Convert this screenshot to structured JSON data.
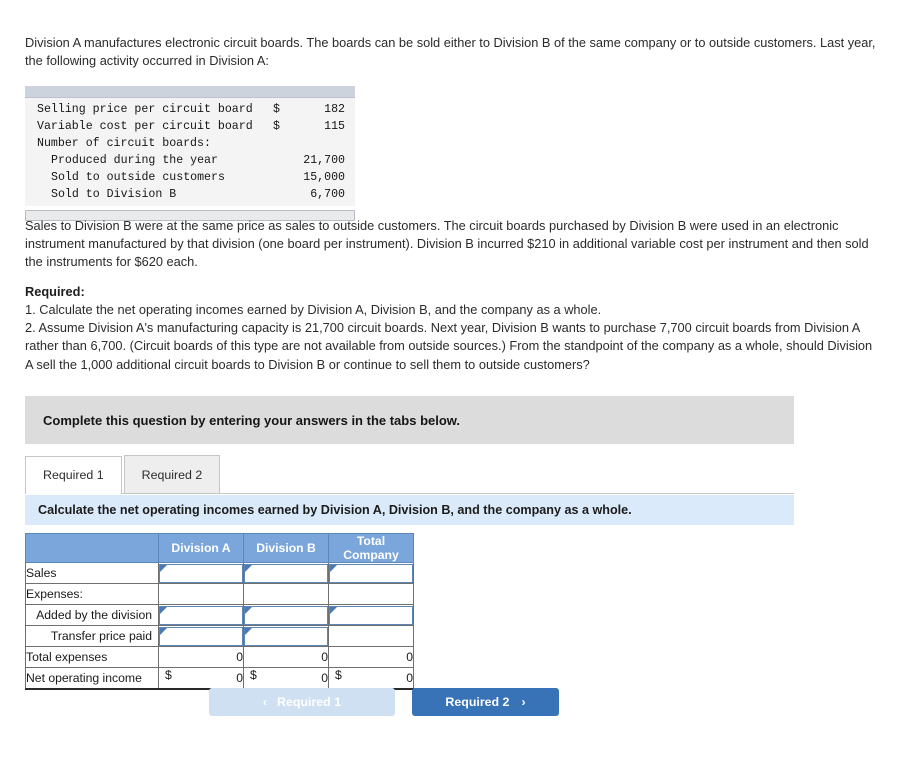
{
  "intro": {
    "paragraph": "Division A manufactures electronic circuit boards. The boards can be sold either to Division B of the same company or to outside customers. Last year, the following activity occurred in Division A:"
  },
  "exhibit": {
    "rows": [
      {
        "label": "Selling price per circuit board",
        "currency": "$",
        "value": "182",
        "indent": false
      },
      {
        "label": "Variable cost per circuit board",
        "currency": "$",
        "value": "115",
        "indent": false
      },
      {
        "label": "Number of circuit boards:",
        "currency": "",
        "value": "",
        "indent": false
      },
      {
        "label": "Produced during the year",
        "currency": "",
        "value": "21,700",
        "indent": true
      },
      {
        "label": "Sold to outside customers",
        "currency": "",
        "value": "15,000",
        "indent": true
      },
      {
        "label": "Sold to Division B",
        "currency": "",
        "value": "6,700",
        "indent": true
      }
    ]
  },
  "para_two": {
    "text": "Sales to Division B were at the same price as sales to outside customers. The circuit boards purchased by Division B were used in an electronic instrument manufactured by that division (one board per instrument). Division B incurred $210 in additional variable cost per instrument and then sold the instruments for $620 each."
  },
  "required": {
    "heading": "Required:",
    "items": [
      "1. Calculate the net operating incomes earned by Division A, Division B, and the company as a whole.",
      "2. Assume Division A's manufacturing capacity is 21,700 circuit boards. Next year, Division B wants to purchase 7,700 circuit boards from Division A rather than 6,700. (Circuit boards of this type are not available from outside sources.) From the standpoint of the company as a whole, should Division A sell the 1,000 additional circuit boards to Division B or continue to sell them to outside customers?"
    ]
  },
  "instruction": {
    "text": "Complete this question by entering your answers in the tabs below."
  },
  "tabs": [
    {
      "label": "Required 1",
      "active": true
    },
    {
      "label": "Required 2",
      "active": false
    }
  ],
  "subtitle": {
    "text": "Calculate the net operating incomes earned by Division A, Division B, and the company as a whole."
  },
  "answer_table": {
    "headers": [
      "",
      "Division A",
      "Division B",
      "Total Company"
    ],
    "rows": [
      {
        "label": "Sales",
        "indent": false,
        "type": "input",
        "cells": [
          {
            "kind": "input",
            "value": ""
          },
          {
            "kind": "input",
            "value": ""
          },
          {
            "kind": "input",
            "value": ""
          }
        ]
      },
      {
        "label": "Expenses:",
        "indent": false,
        "type": "blank",
        "cells": [
          {
            "kind": "blank",
            "value": ""
          },
          {
            "kind": "blank",
            "value": ""
          },
          {
            "kind": "blank",
            "value": ""
          }
        ]
      },
      {
        "label": "Added by the division",
        "indent": true,
        "type": "input",
        "cells": [
          {
            "kind": "input",
            "value": ""
          },
          {
            "kind": "input",
            "value": ""
          },
          {
            "kind": "input",
            "value": ""
          }
        ]
      },
      {
        "label": "Transfer price paid",
        "indent": true,
        "type": "input",
        "cells": [
          {
            "kind": "input",
            "value": ""
          },
          {
            "kind": "input",
            "value": ""
          },
          {
            "kind": "blank",
            "value": ""
          }
        ]
      },
      {
        "label": "Total expenses",
        "indent": false,
        "type": "total",
        "cells": [
          {
            "kind": "number",
            "value": "0"
          },
          {
            "kind": "number",
            "value": "0"
          },
          {
            "kind": "number",
            "value": "0"
          }
        ]
      },
      {
        "label": "Net operating income",
        "indent": false,
        "type": "net",
        "cells": [
          {
            "kind": "money",
            "currency": "$",
            "value": "0"
          },
          {
            "kind": "money",
            "currency": "$",
            "value": "0"
          },
          {
            "kind": "money",
            "currency": "$",
            "value": "0"
          }
        ]
      }
    ]
  },
  "navigation": {
    "prev_label": "Required 1",
    "prev_chevron": "‹",
    "next_label": "Required 2",
    "next_chevron": "›"
  },
  "colors": {
    "header_blue": "#7aa6dc",
    "subtitle_blue": "#dbeafb",
    "banner_gray": "#dcdcdc",
    "button_blue": "#3873b8",
    "button_disabled": "#cfe0f2",
    "input_border": "#5f87b5"
  }
}
